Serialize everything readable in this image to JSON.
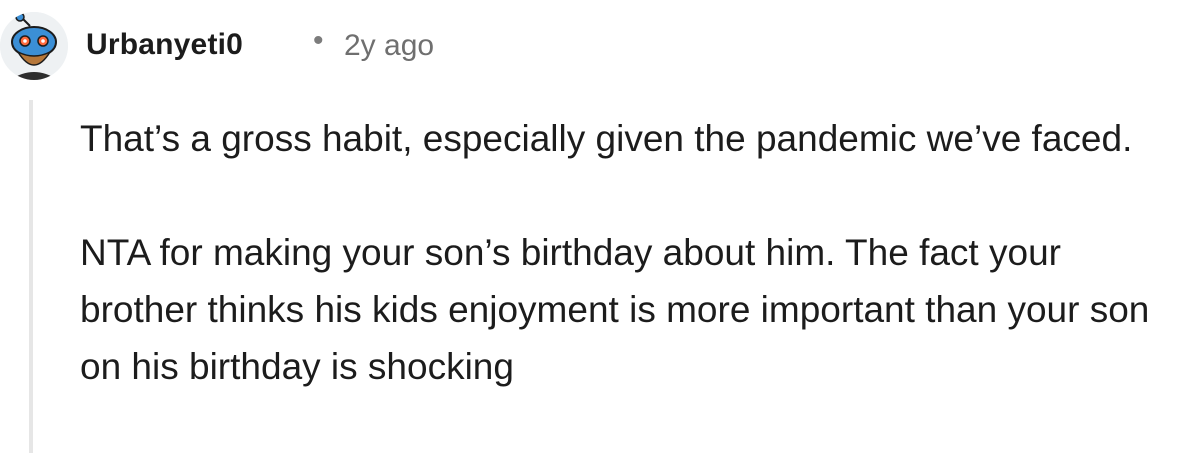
{
  "comment": {
    "author": "Urbanyeti0",
    "separator": "•",
    "time": "2y ago",
    "paragraphs": [
      "That’s a gross habit, especially given the pandemic we’ve faced.",
      "NTA for making your son’s birthday about him. The fact your brother thinks his kids enjoyment is more important than your son on his birthday is shocking"
    ]
  },
  "colors": {
    "text": "#1c1c1c",
    "meta": "#6f6f6f",
    "thread_line": "#e6e6e6",
    "avatar_blue": "#3b8fd6",
    "avatar_orange": "#ff6a3d"
  },
  "icons": {
    "avatar": "reddit-snoo-avatar-icon"
  }
}
